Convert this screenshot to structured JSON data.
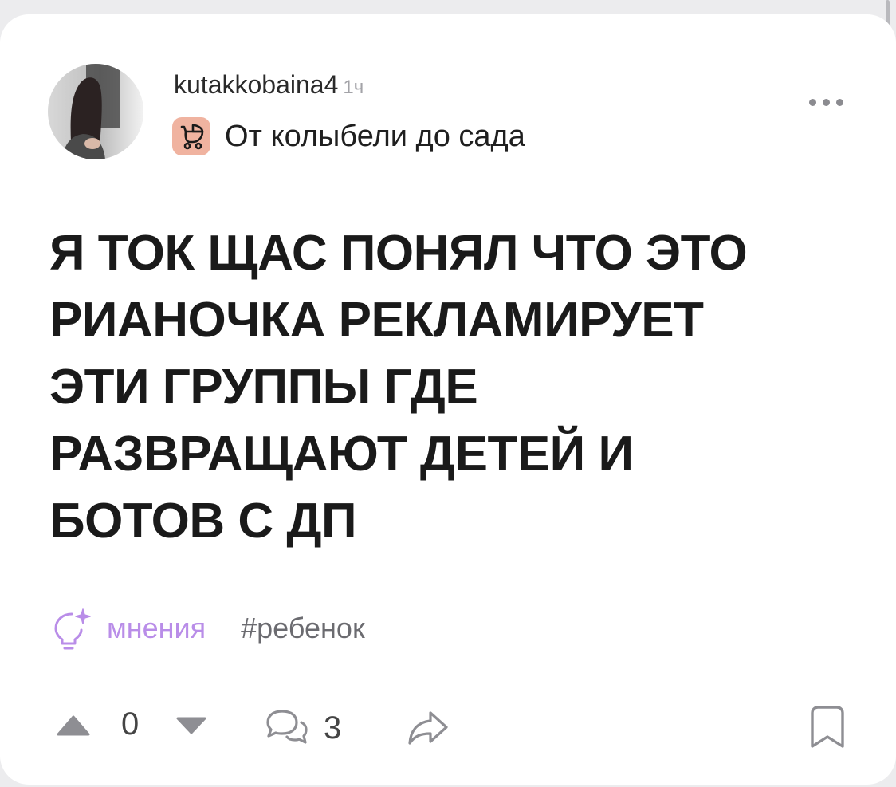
{
  "post": {
    "author": {
      "username": "kutakkobaina4",
      "time": "1ч"
    },
    "community": {
      "name": "От колыбели до сада",
      "icon": "baby-stroller-icon",
      "icon_bg": "#f0b3a0"
    },
    "more_icon": "more-dots-icon",
    "text_lines": [
      "Я ТОК ЩАС ПОНЯЛ ЧТО ЭТО",
      "РИАНОЧКА РЕКЛАМИРУЕТ",
      "ЭТИ ГРУППЫ ГДЕ",
      "РАЗВРАЩАЮТ ДЕТЕЙ И",
      "БОТОВ С ДП"
    ],
    "tags": {
      "opinion": "мнения",
      "opinion_color": "#b98de8",
      "hashtag": "#ребенок"
    },
    "actions": {
      "vote_count": "0",
      "comment_count": "3"
    }
  }
}
